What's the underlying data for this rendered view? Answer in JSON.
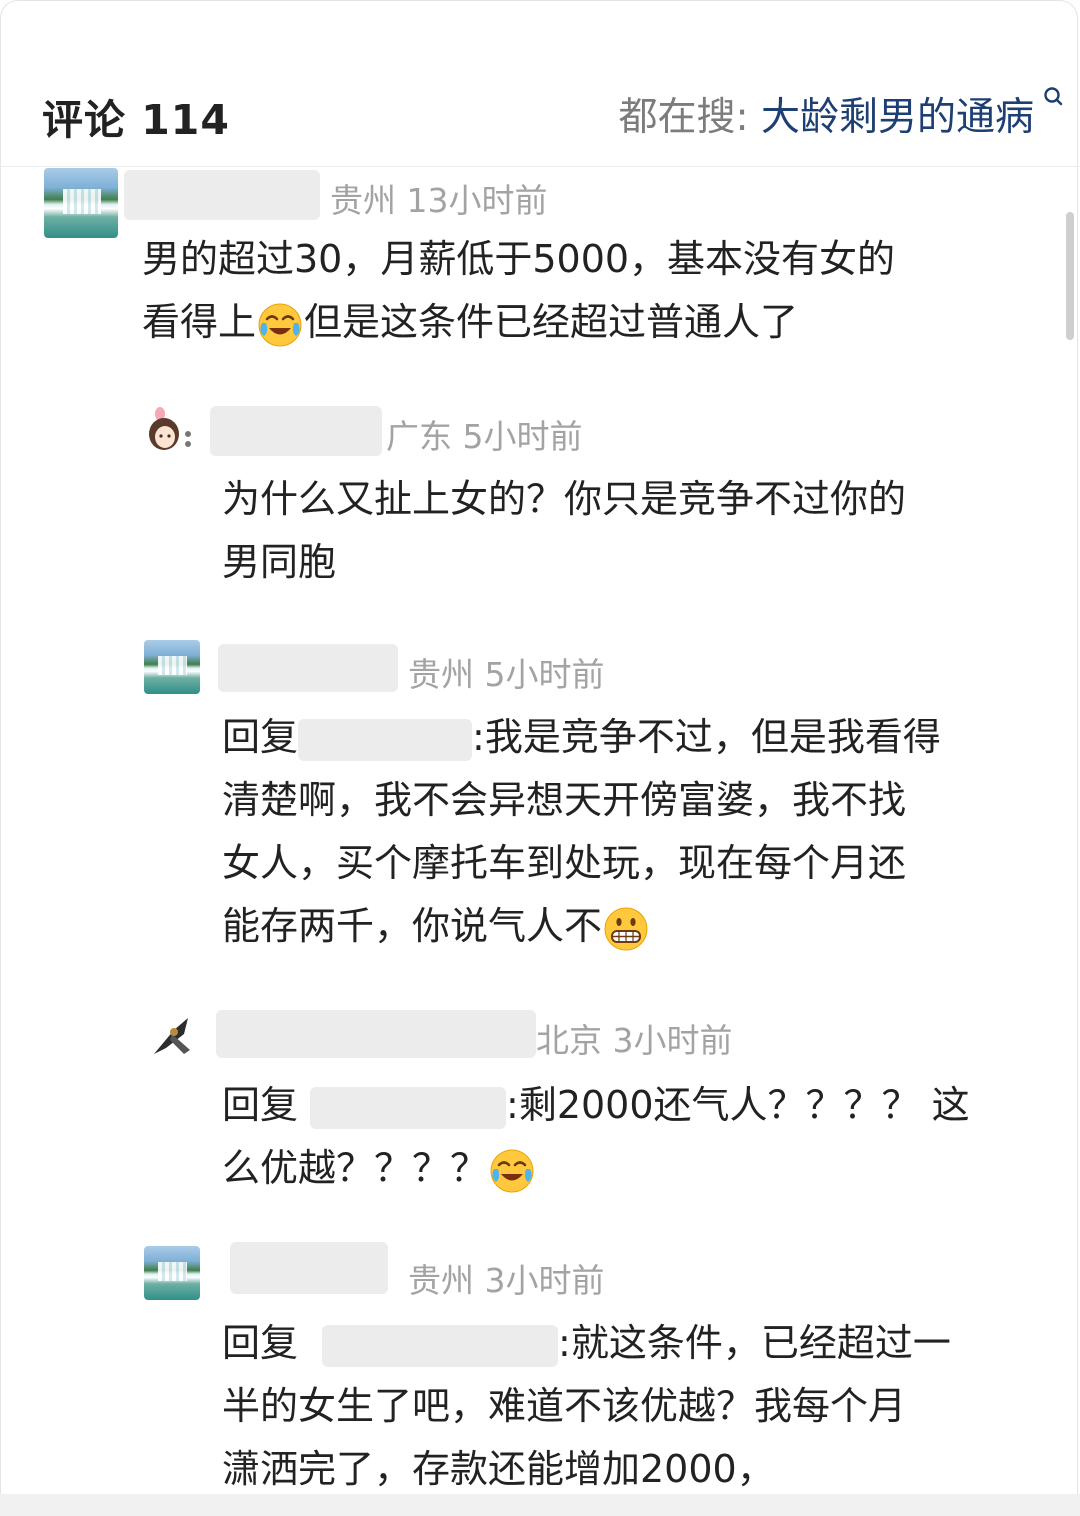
{
  "header": {
    "title": "评论 114",
    "search_label": "都在搜:",
    "search_keyword": "大龄剩男的通病"
  },
  "comments": [
    {
      "location_time": "贵州 13小时前",
      "lines": [
        "男的超过30，月薪低于5000，基本没有女的",
        "看得上",
        "但是这条件已经超过普通人了"
      ]
    },
    {
      "location_time": "广东 5小时前",
      "lines": [
        "为什么又扯上女的？你只是竞争不过你的",
        "男同胞"
      ]
    },
    {
      "location_time": "贵州 5小时前",
      "reply_prefix": "回复",
      "lines": [
        ":我是竞争不过，但是我看得",
        "清楚啊，我不会异想天开傍富婆，我不找",
        "女人，买个摩托车到处玩，现在每个月还",
        "能存两千，你说气人不"
      ]
    },
    {
      "location_time": "北京 3小时前",
      "reply_prefix": "回复",
      "lines": [
        ":剩2000还气人？？？？ 这",
        "么优越？？？？"
      ]
    },
    {
      "location_time": "贵州 3小时前",
      "reply_prefix": "回复",
      "lines": [
        ":就这条件，已经超过一",
        "半的女生了吧，难道不该优越？我每个月",
        "潇洒完了，存款还能增加2000，"
      ]
    }
  ],
  "icons": {
    "search": "search-icon",
    "cry_laugh": "face-with-tears-of-joy-emoji",
    "grin": "grinning-face-emoji"
  }
}
